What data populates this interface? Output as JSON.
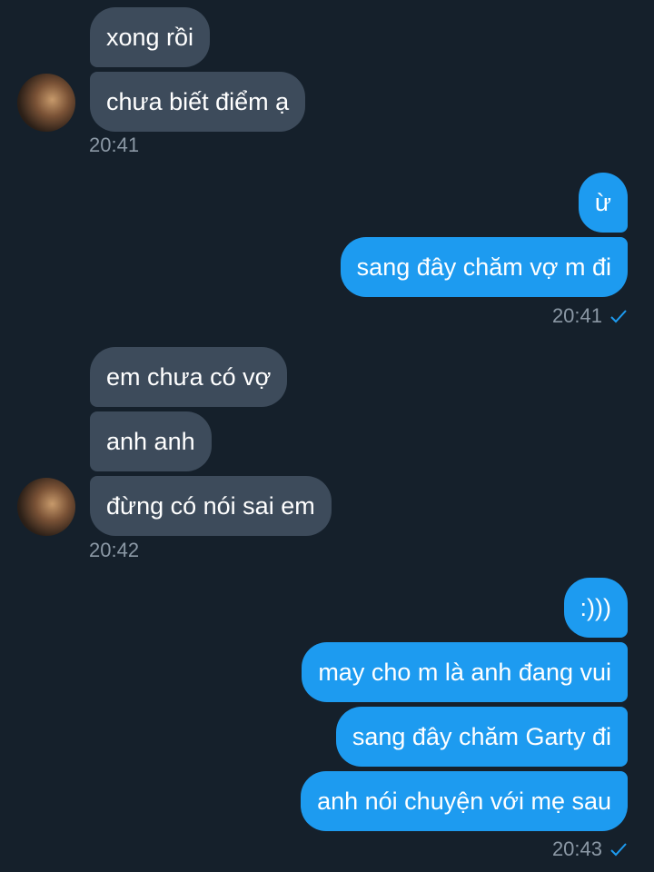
{
  "colors": {
    "background": "#15202b",
    "incoming_bubble": "#3d4b5b",
    "outgoing_bubble": "#1d9bf0",
    "timestamp": "#8b98a5"
  },
  "messages": {
    "group1": {
      "m1": "xong rồi",
      "m2": "chưa biết điểm ạ",
      "time": "20:41"
    },
    "group2": {
      "m1": "ừ",
      "m2": "sang đây chăm vợ m đi",
      "time": "20:41"
    },
    "group3": {
      "m1": "em chưa có vợ",
      "m2": "anh anh",
      "m3": "đừng có nói sai em",
      "time": "20:42"
    },
    "group4": {
      "m1": ":)))",
      "m2": "may cho m là anh đang vui",
      "m3": "sang đây chăm Garty đi",
      "m4": "anh nói chuyện với mẹ sau",
      "time": "20:43"
    }
  },
  "icons": {
    "read_receipt": "checkmark-icon",
    "avatar": "avatar"
  }
}
